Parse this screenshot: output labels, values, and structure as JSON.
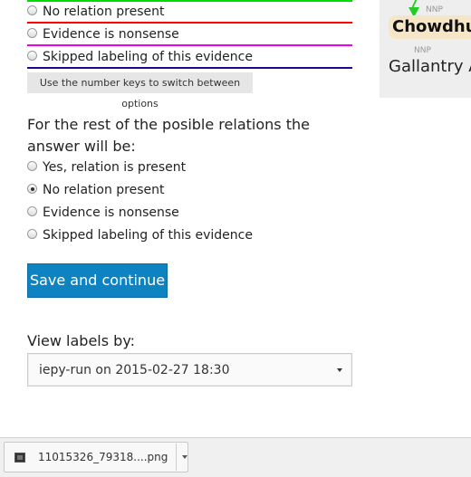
{
  "top_options": [
    {
      "label": "No relation present",
      "checked": false,
      "color": "#ff0000"
    },
    {
      "label": "Evidence is nonsense",
      "checked": false,
      "color": "#ee00ee"
    },
    {
      "label": "Skipped labeling of this evidence",
      "checked": false,
      "color": "#1a0a8f"
    }
  ],
  "top_line_color": "#00dd00",
  "hint_text": "Use the number keys to switch between options",
  "rest_question": "For the rest of the posible relations the answer will be:",
  "rest_options": [
    {
      "label": "Yes, relation is present",
      "checked": false
    },
    {
      "label": "No relation present",
      "checked": true
    },
    {
      "label": "Evidence is nonsense",
      "checked": false
    },
    {
      "label": "Skipped labeling of this evidence",
      "checked": false
    }
  ],
  "save_button": "Save and continue",
  "view_labels": {
    "label": "View labels by:",
    "selected": "iepy-run on 2015-02-27 18:30"
  },
  "side_panel": {
    "token_tag_1": "NNP",
    "token_1": "Chowdhu",
    "token_tag_2": "NNP",
    "token_2": "Gallantry A"
  },
  "download": {
    "filename": "11015326_79318....png"
  }
}
